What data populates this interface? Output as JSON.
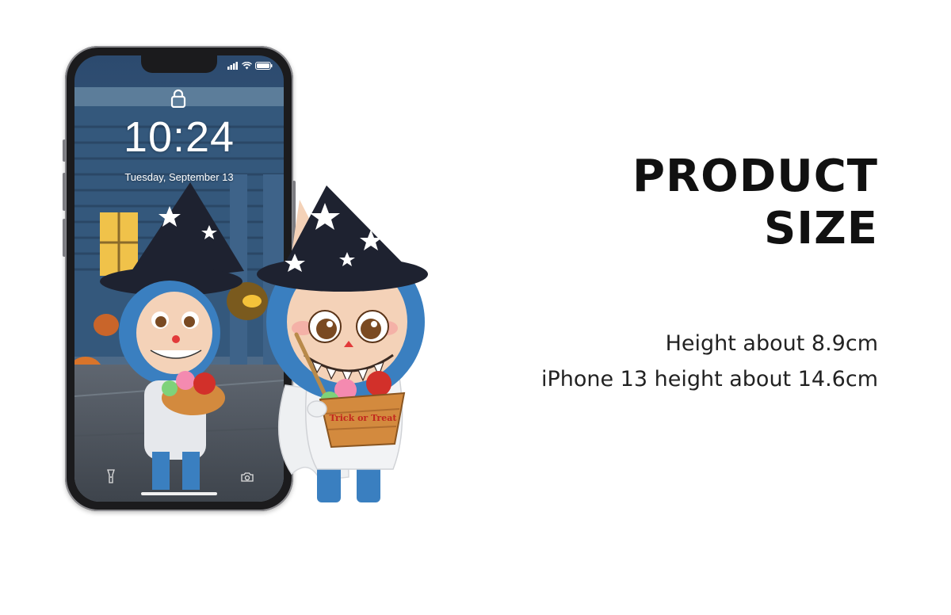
{
  "phone": {
    "lock_time": "10:24",
    "lock_date": "Tuesday, September 13"
  },
  "heading": {
    "line1": "PRODUCT",
    "line2": "SIZE"
  },
  "specs": {
    "figure_height": "Height about 8.9cm",
    "phone_height": "iPhone 13 height about 14.6cm"
  },
  "basket_label": "Trick or Treat",
  "colors": {
    "hat": "#1e2230",
    "fur_blue": "#3a7fc0",
    "face": "#f4d2b8",
    "basket": "#d38a3e"
  }
}
